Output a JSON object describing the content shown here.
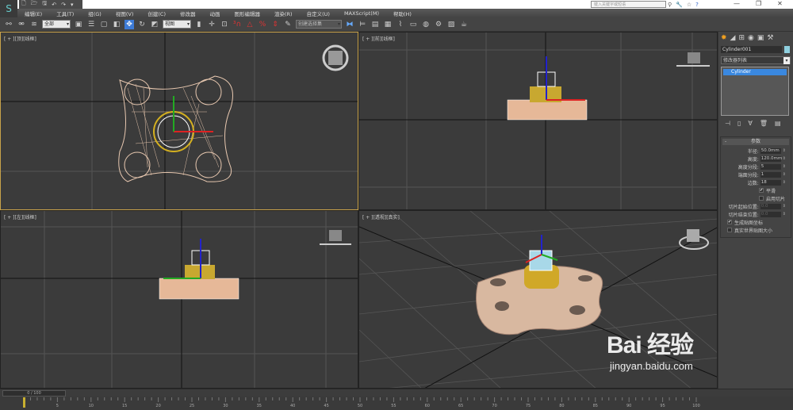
{
  "app": {
    "logo": "S"
  },
  "quick_access": [
    "🗋",
    "🗁",
    "🖫",
    "↶",
    "↷",
    "▾"
  ],
  "search": {
    "placeholder": "键入关键字或短语"
  },
  "search_tools": [
    "⚲",
    "🔧",
    "☆",
    "?"
  ],
  "window_controls": [
    "—",
    "❐",
    "✕"
  ],
  "menu": [
    "编辑(E)",
    "工具(T)",
    "组(G)",
    "视图(V)",
    "创建(C)",
    "修改器",
    "动画",
    "图形编辑器",
    "渲染(R)",
    "自定义(U)",
    "MAXScript(M)",
    "帮助(H)"
  ],
  "toolbar": {
    "selection_filter": "全部",
    "ref_coord": "视图",
    "named_selection": "创建选择集"
  },
  "viewports": [
    {
      "label": "[ + ][顶][线框]"
    },
    {
      "label": "[ + ][前][线框]"
    },
    {
      "label": "[ + ][左][线框]"
    },
    {
      "label": "[ + ][透视][真实]"
    }
  ],
  "command_panel": {
    "object_name": "Cylinder001",
    "object_color": "#8fd0df",
    "modifier_list": "修改器列表",
    "stack": [
      "Cylinder"
    ],
    "rollout_title": "参数",
    "params": [
      {
        "label": "半径:",
        "value": "50.0mm"
      },
      {
        "label": "高度:",
        "value": "120.0mm"
      },
      {
        "label": "高度分段:",
        "value": "5"
      },
      {
        "label": "端面分段:",
        "value": "1"
      },
      {
        "label": "边数:",
        "value": "18"
      }
    ],
    "smooth": {
      "label": "平滑",
      "checked": true
    },
    "slice_on": {
      "label": "启用切片",
      "checked": false
    },
    "slice_from": {
      "label": "切片起始位置:",
      "value": "0.0"
    },
    "slice_to": {
      "label": "切片结束位置:",
      "value": "0.0"
    },
    "gen_map": {
      "label": "生成贴图坐标",
      "checked": true
    },
    "real_world": {
      "label": "真实世界贴图大小",
      "checked": false
    }
  },
  "timeline": {
    "frame": "0 / 100",
    "current": 0,
    "total": 100,
    "ticks": [
      "5",
      "10",
      "15",
      "20",
      "25",
      "30",
      "35",
      "40",
      "45",
      "50",
      "55",
      "60",
      "65",
      "70",
      "75",
      "80",
      "85",
      "90",
      "95",
      "100"
    ]
  },
  "watermark": {
    "logo": "Bai 经验",
    "url": "jingyan.baidu.com"
  }
}
